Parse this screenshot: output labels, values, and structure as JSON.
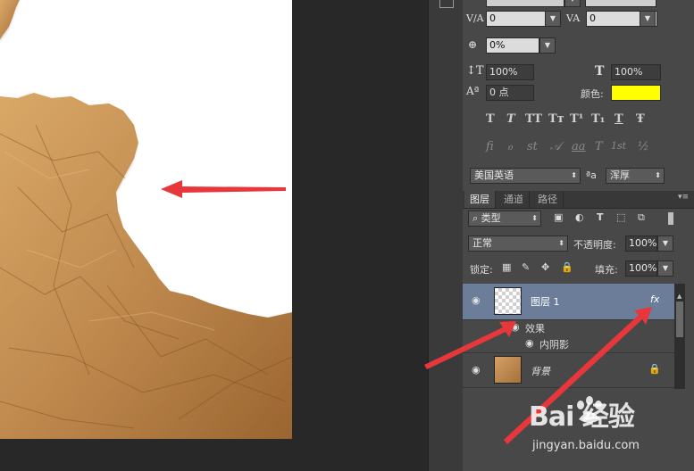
{
  "top_partial": {
    "tracking_value": "0",
    "kerning_value": "0"
  },
  "character": {
    "baseline_shift_pct": "0%",
    "vertical_scale": "100%",
    "horizontal_scale": "100%",
    "baseline": "0 点",
    "color_label": "颜色:",
    "color_swatch": "#ffff00",
    "style_glyphs": [
      "T",
      "T",
      "TT",
      "Tт",
      "T¹",
      "T₁",
      "T",
      "Ŧ"
    ],
    "opentype_glyphs": [
      "fi",
      "ℴ",
      "st",
      "𝒜",
      "aa",
      "T",
      "1st",
      "½"
    ],
    "language": "美国英语",
    "aa_symbol": "ªa",
    "antialias": "浑厚"
  },
  "layers_panel": {
    "tabs": [
      "图层",
      "通道",
      "路径"
    ],
    "filter_kind": "类型",
    "blend_mode": "正常",
    "opacity_label": "不透明度:",
    "opacity_value": "100%",
    "lock_label": "锁定:",
    "fill_label": "填充:",
    "fill_value": "100%",
    "layers": [
      {
        "name": "图层 1",
        "fx": "fx",
        "selected": true
      },
      {
        "name": "背景",
        "locked": true
      }
    ],
    "effects_label": "效果",
    "effect_item": "内阴影"
  },
  "watermark": {
    "logo": "Bai 经验",
    "site": "jingyan.baidu.com"
  },
  "colors": {
    "panel": "#484848",
    "selected_layer": "#6b7d99",
    "arrow": "#e8373a",
    "paper": "#c08a4f"
  }
}
